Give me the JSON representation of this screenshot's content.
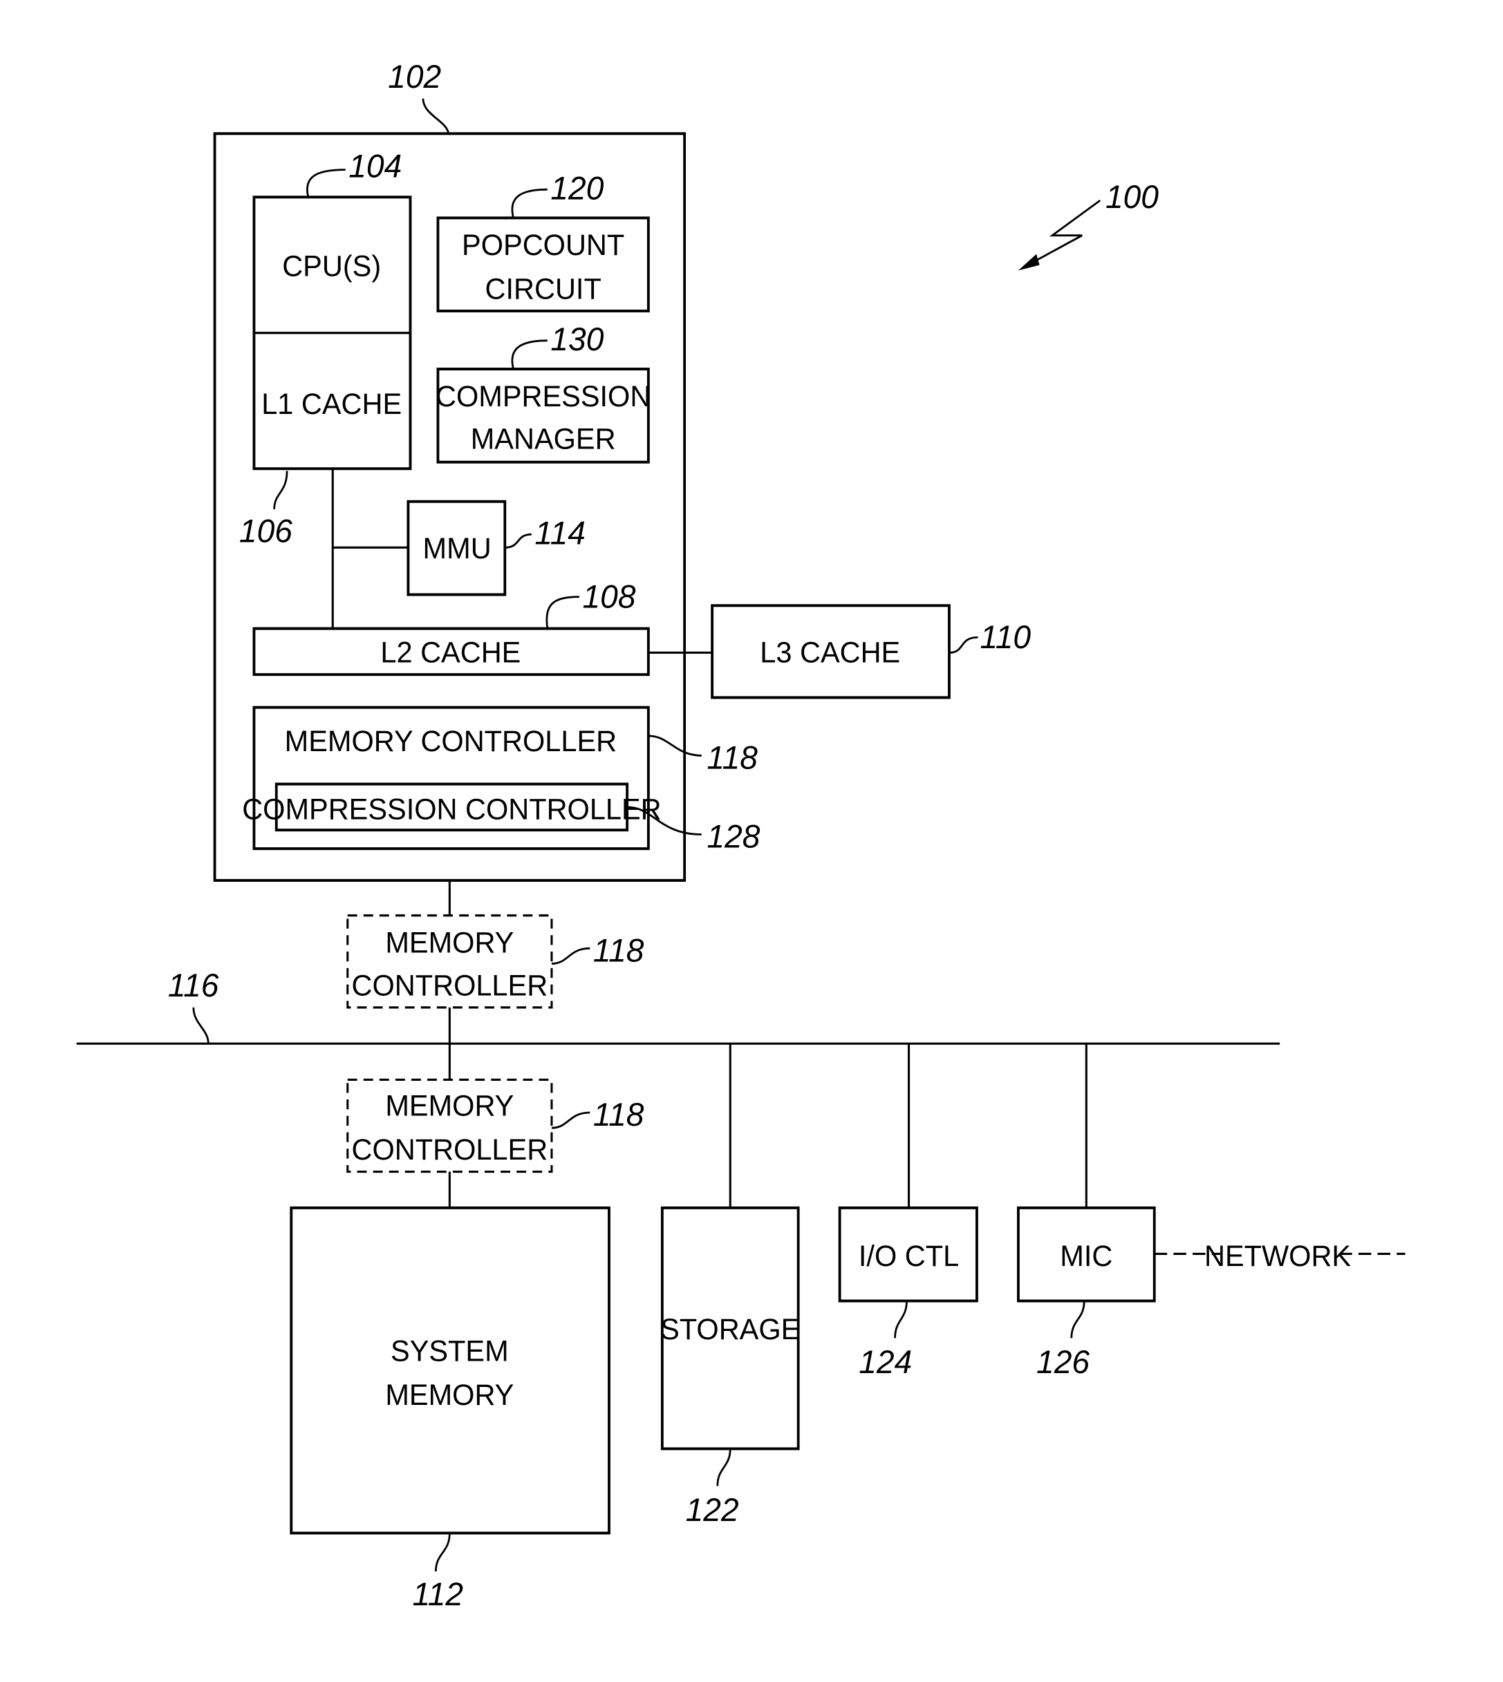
{
  "figure": {
    "ref": "100",
    "blocks": {
      "processor": {
        "ref": "102"
      },
      "cpu": {
        "label": "CPU(S)",
        "ref": "104"
      },
      "l1": {
        "label": "L1 CACHE",
        "ref": "106"
      },
      "popcount": {
        "line1": "POPCOUNT",
        "line2": "CIRCUIT",
        "ref": "120"
      },
      "compmgr": {
        "line1": "COMPRESSION",
        "line2": "MANAGER",
        "ref": "130"
      },
      "mmu": {
        "label": "MMU",
        "ref": "114"
      },
      "l2": {
        "label": "L2 CACHE",
        "ref": "108"
      },
      "l3": {
        "label": "L3 CACHE",
        "ref": "110"
      },
      "memctl_internal": {
        "label": "MEMORY CONTROLLER",
        "ref": "118"
      },
      "compctl": {
        "label": "COMPRESSION CONTROLLER",
        "ref": "128"
      },
      "memctl_upper": {
        "line1": "MEMORY",
        "line2": "CONTROLLER",
        "ref": "118"
      },
      "bus": {
        "ref": "116"
      },
      "memctl_lower": {
        "line1": "MEMORY",
        "line2": "CONTROLLER",
        "ref": "118"
      },
      "sysmem": {
        "line1": "SYSTEM",
        "line2": "MEMORY",
        "ref": "112"
      },
      "storage": {
        "label": "STORAGE",
        "ref": "122"
      },
      "ioctl": {
        "label": "I/O CTL",
        "ref": "124"
      },
      "mic": {
        "label": "MIC",
        "ref": "126"
      },
      "network": {
        "label": "NETWORK"
      }
    }
  }
}
